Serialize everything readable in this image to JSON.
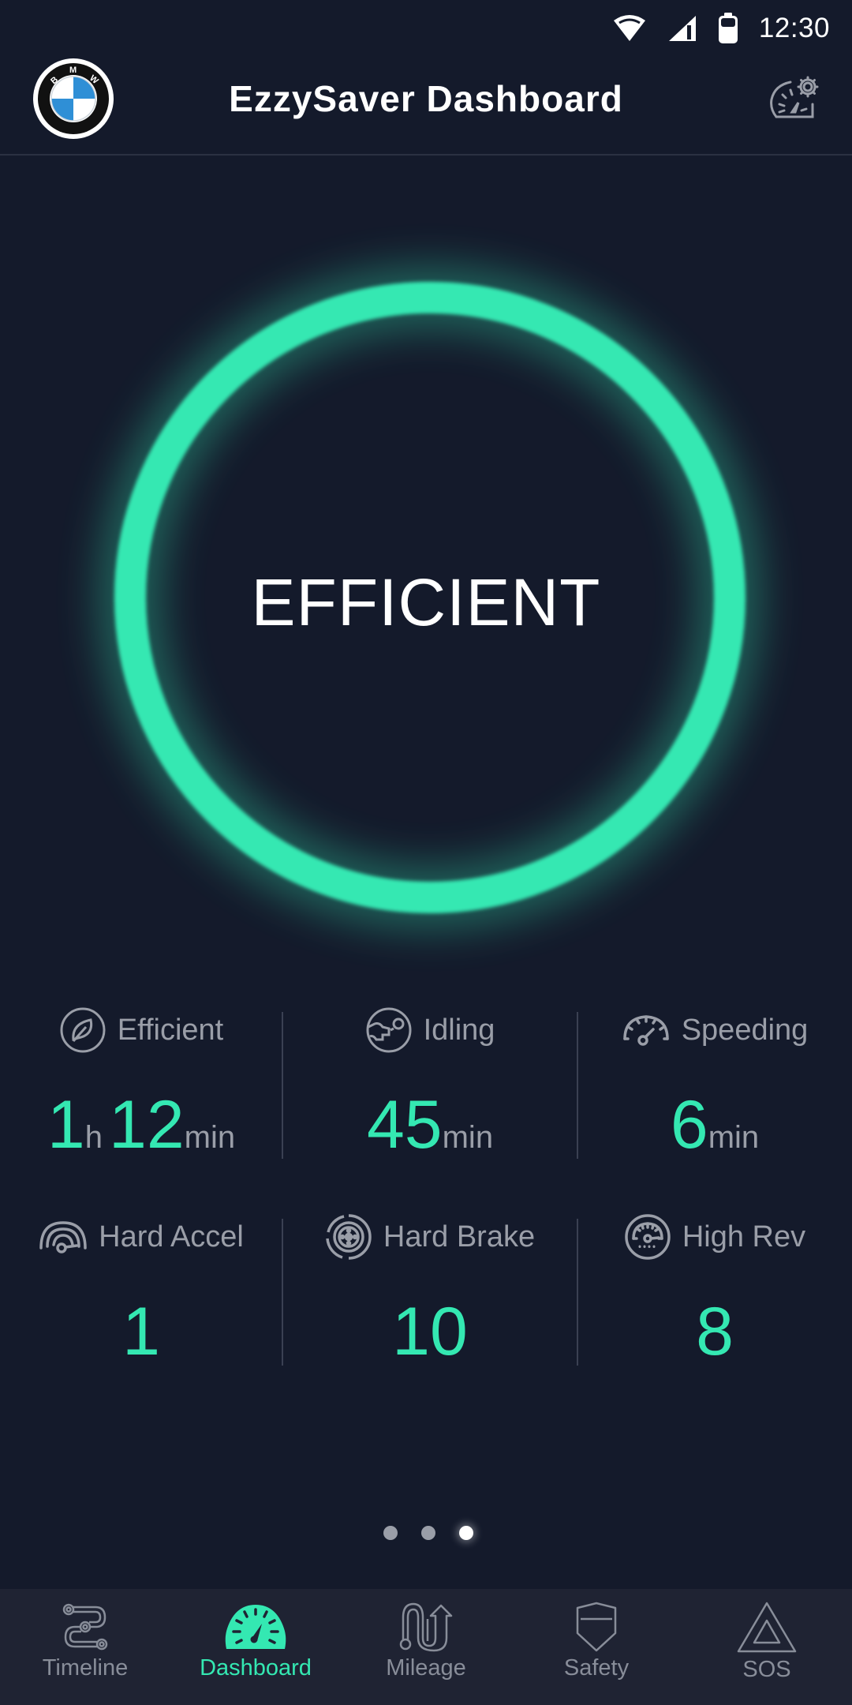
{
  "status_bar": {
    "time": "12:30",
    "icons": [
      "wifi-icon",
      "cellular-signal-icon",
      "battery-icon"
    ]
  },
  "app_bar": {
    "title": "EzzySaver Dashboard",
    "logo": "bmw-logo",
    "logo_letters": "BMW",
    "settings_icon": "speedometer-gear-icon"
  },
  "ring": {
    "label": "EFFICIENT",
    "color": "#34e8b2",
    "status": "efficient"
  },
  "stats": [
    {
      "id": "efficient",
      "label": "Efficient",
      "icon": "leaf-icon",
      "value_parts": [
        {
          "text": "1",
          "kind": "num"
        },
        {
          "text": "h",
          "kind": "unit-h"
        },
        {
          "text": "12",
          "kind": "num"
        },
        {
          "text": "min",
          "kind": "unit"
        }
      ]
    },
    {
      "id": "idling",
      "label": "Idling",
      "icon": "idling-engine-icon",
      "value_parts": [
        {
          "text": "45",
          "kind": "num"
        },
        {
          "text": "min",
          "kind": "unit"
        }
      ]
    },
    {
      "id": "speeding",
      "label": "Speeding",
      "icon": "speedometer-icon",
      "value_parts": [
        {
          "text": "6",
          "kind": "num"
        },
        {
          "text": "min",
          "kind": "unit"
        }
      ]
    },
    {
      "id": "hard-accel",
      "label": "Hard Accel",
      "icon": "hard-accel-icon",
      "value_parts": [
        {
          "text": "1",
          "kind": "num"
        }
      ]
    },
    {
      "id": "hard-brake",
      "label": "Hard Brake",
      "icon": "brake-disc-icon",
      "value_parts": [
        {
          "text": "10",
          "kind": "num"
        }
      ]
    },
    {
      "id": "high-rev",
      "label": "High Rev",
      "icon": "tachometer-icon",
      "value_parts": [
        {
          "text": "8",
          "kind": "num"
        }
      ]
    }
  ],
  "pager": {
    "count": 3,
    "active_index": 2
  },
  "bottom_nav": {
    "active": "dashboard",
    "items": [
      {
        "id": "timeline",
        "label": "Timeline",
        "icon": "route-timeline-icon"
      },
      {
        "id": "dashboard",
        "label": "Dashboard",
        "icon": "dashboard-gauge-icon"
      },
      {
        "id": "mileage",
        "label": "Mileage",
        "icon": "winding-road-arrow-icon"
      },
      {
        "id": "safety",
        "label": "Safety",
        "icon": "shield-icon"
      },
      {
        "id": "sos",
        "label": "SOS",
        "icon": "warning-triangle-icon"
      }
    ]
  },
  "colors": {
    "background": "#141a2b",
    "accent": "#34e8b2",
    "muted_text": "#9a9ea8",
    "nav_background": "#1f2333"
  }
}
